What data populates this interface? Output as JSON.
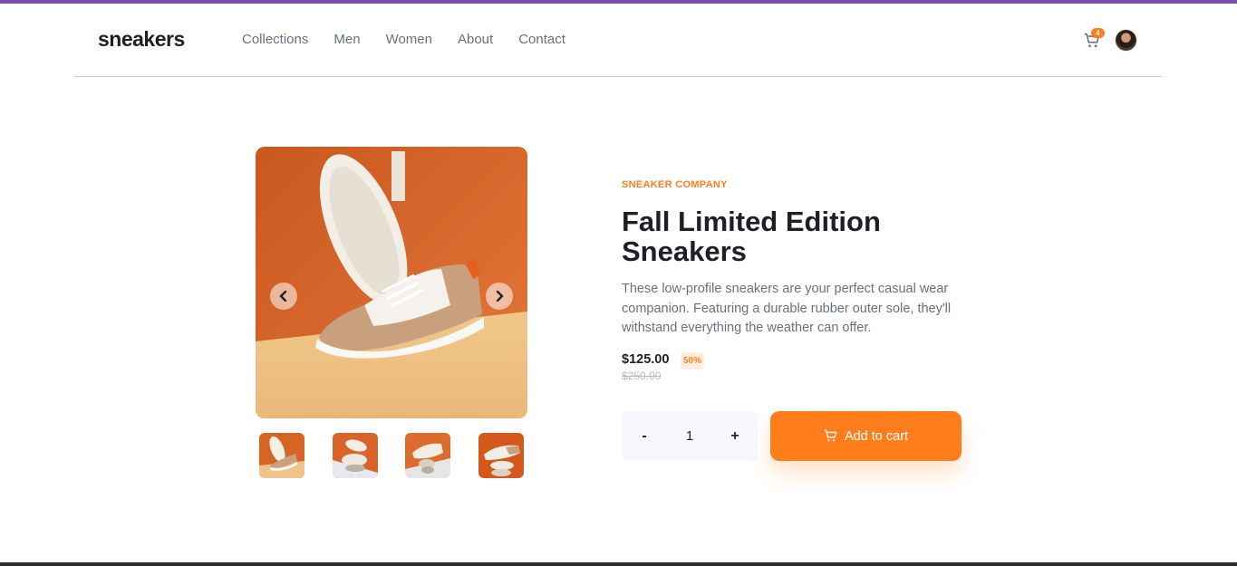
{
  "brand": {
    "logo": "sneakers"
  },
  "nav": {
    "items": [
      {
        "label": "Collections"
      },
      {
        "label": "Men"
      },
      {
        "label": "Women"
      },
      {
        "label": "About"
      },
      {
        "label": "Contact"
      }
    ]
  },
  "header": {
    "cart_icon": "cart-icon",
    "cart_count": "4",
    "avatar": "user-avatar"
  },
  "gallery": {
    "prev_icon": "chevron-left-icon",
    "next_icon": "chevron-right-icon",
    "thumbnails": 4
  },
  "product": {
    "company": "SNEAKER COMPANY",
    "title": "Fall Limited Edition Sneakers",
    "description": "These low-profile sneakers are your perfect casual wear companion. Featuring a durable rubber outer sole, they'll withstand everything the weather can offer.",
    "price": "$125.00",
    "discount": "50%",
    "original_price": "$250.00"
  },
  "quantity": {
    "minus": "-",
    "value": "1",
    "plus": "+"
  },
  "add_to_cart": {
    "label": "Add to cart",
    "icon": "cart-icon"
  },
  "colors": {
    "accent": "#ff7e1b",
    "accent_pale": "#ffede0",
    "text_dark": "#1d2026",
    "text_gray": "#69707d"
  }
}
